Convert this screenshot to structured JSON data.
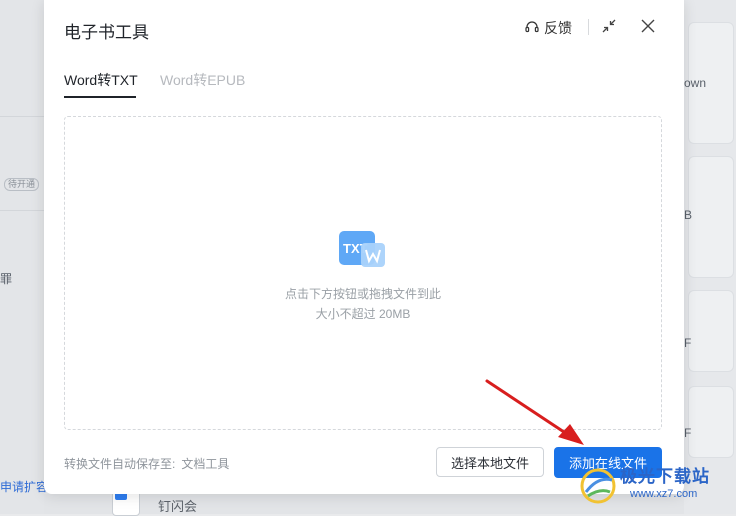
{
  "background": {
    "left_texts": [
      "罪"
    ],
    "badge": "待开通",
    "link": "申请扩容",
    "right_texts": [
      "own",
      "B",
      "F",
      "F"
    ],
    "app_name": "钉闪会"
  },
  "modal": {
    "title": "电子书工具",
    "feedback_label": "反馈",
    "tabs": [
      {
        "label": "Word转TXT",
        "active": true
      },
      {
        "label": "Word转EPUB",
        "active": false
      }
    ],
    "dropzone": {
      "badge_label": "TXT",
      "hint_line1": "点击下方按钮或拖拽文件到此",
      "hint_line2": "大小不超过 20MB"
    },
    "footer": {
      "save_prefix": "转换文件自动保存至:",
      "save_dest": "文档工具",
      "local_button": "选择本地文件",
      "online_button": "添加在线文件"
    }
  },
  "watermark": {
    "title": "极光下载站",
    "url": "www.xz7.com"
  },
  "colors": {
    "primary": "#1a73e8",
    "arrow": "#d81e1e",
    "icon_blue": "#3b8cf3"
  },
  "icons": [
    "headset-icon",
    "collapse-icon",
    "close-icon",
    "txt-document-icon"
  ]
}
